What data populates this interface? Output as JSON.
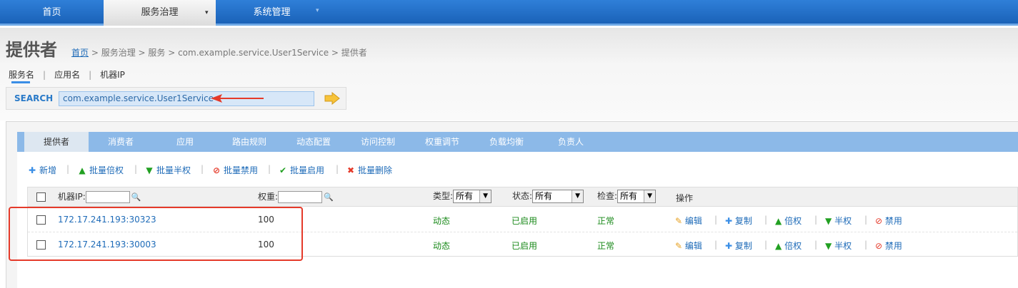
{
  "topnav": {
    "items": [
      {
        "label": "首页"
      },
      {
        "label": "服务治理",
        "caret": "▾"
      },
      {
        "label": "系统管理",
        "caret": "▾"
      }
    ]
  },
  "page": {
    "title": "提供者",
    "breadcrumb": {
      "home": "首页",
      "rest": " > 服务治理 > 服务 > com.example.service.User1Service > 提供者"
    }
  },
  "search": {
    "tabs": [
      {
        "label": "服务名"
      },
      {
        "label": "应用名"
      },
      {
        "label": "机器IP"
      }
    ],
    "label": "SEARCH",
    "value": "com.example.service.User1Service"
  },
  "tabs": [
    {
      "label": "提供者"
    },
    {
      "label": "消费者"
    },
    {
      "label": "应用"
    },
    {
      "label": "路由规则"
    },
    {
      "label": "动态配置"
    },
    {
      "label": "访问控制"
    },
    {
      "label": "权重调节"
    },
    {
      "label": "负载均衡"
    },
    {
      "label": "负责人"
    }
  ],
  "toolbar": [
    {
      "label": "新增",
      "icon": "plus-icon"
    },
    {
      "label": "批量倍权",
      "icon": "up-arrow-icon"
    },
    {
      "label": "批量半权",
      "icon": "down-arrow-icon"
    },
    {
      "label": "批量禁用",
      "icon": "ban-icon"
    },
    {
      "label": "批量启用",
      "icon": "check-icon"
    },
    {
      "label": "批量删除",
      "icon": "x-icon"
    }
  ],
  "table": {
    "headers": {
      "ip": "机器IP:",
      "weight": "权重:",
      "type": "类型:",
      "type_value": "所有",
      "status": "状态:",
      "status_value": "所有",
      "check": "检查:",
      "check_value": "所有",
      "ops": "操作"
    },
    "rows": [
      {
        "ip": "172.17.241.193:30323",
        "weight": "100",
        "type": "动态",
        "status": "已启用",
        "check": "正常"
      },
      {
        "ip": "172.17.241.193:30003",
        "weight": "100",
        "type": "动态",
        "status": "已启用",
        "check": "正常"
      }
    ],
    "ops": {
      "edit": "编辑",
      "copy": "复制",
      "double": "倍权",
      "half": "半权",
      "disable": "禁用"
    }
  },
  "colors": {
    "nav": "#1f6bc2",
    "tabbar": "#8cb9e8",
    "link": "#1e6bb8",
    "ok": "#1b8a1b",
    "annotation": "#e53a2a"
  }
}
